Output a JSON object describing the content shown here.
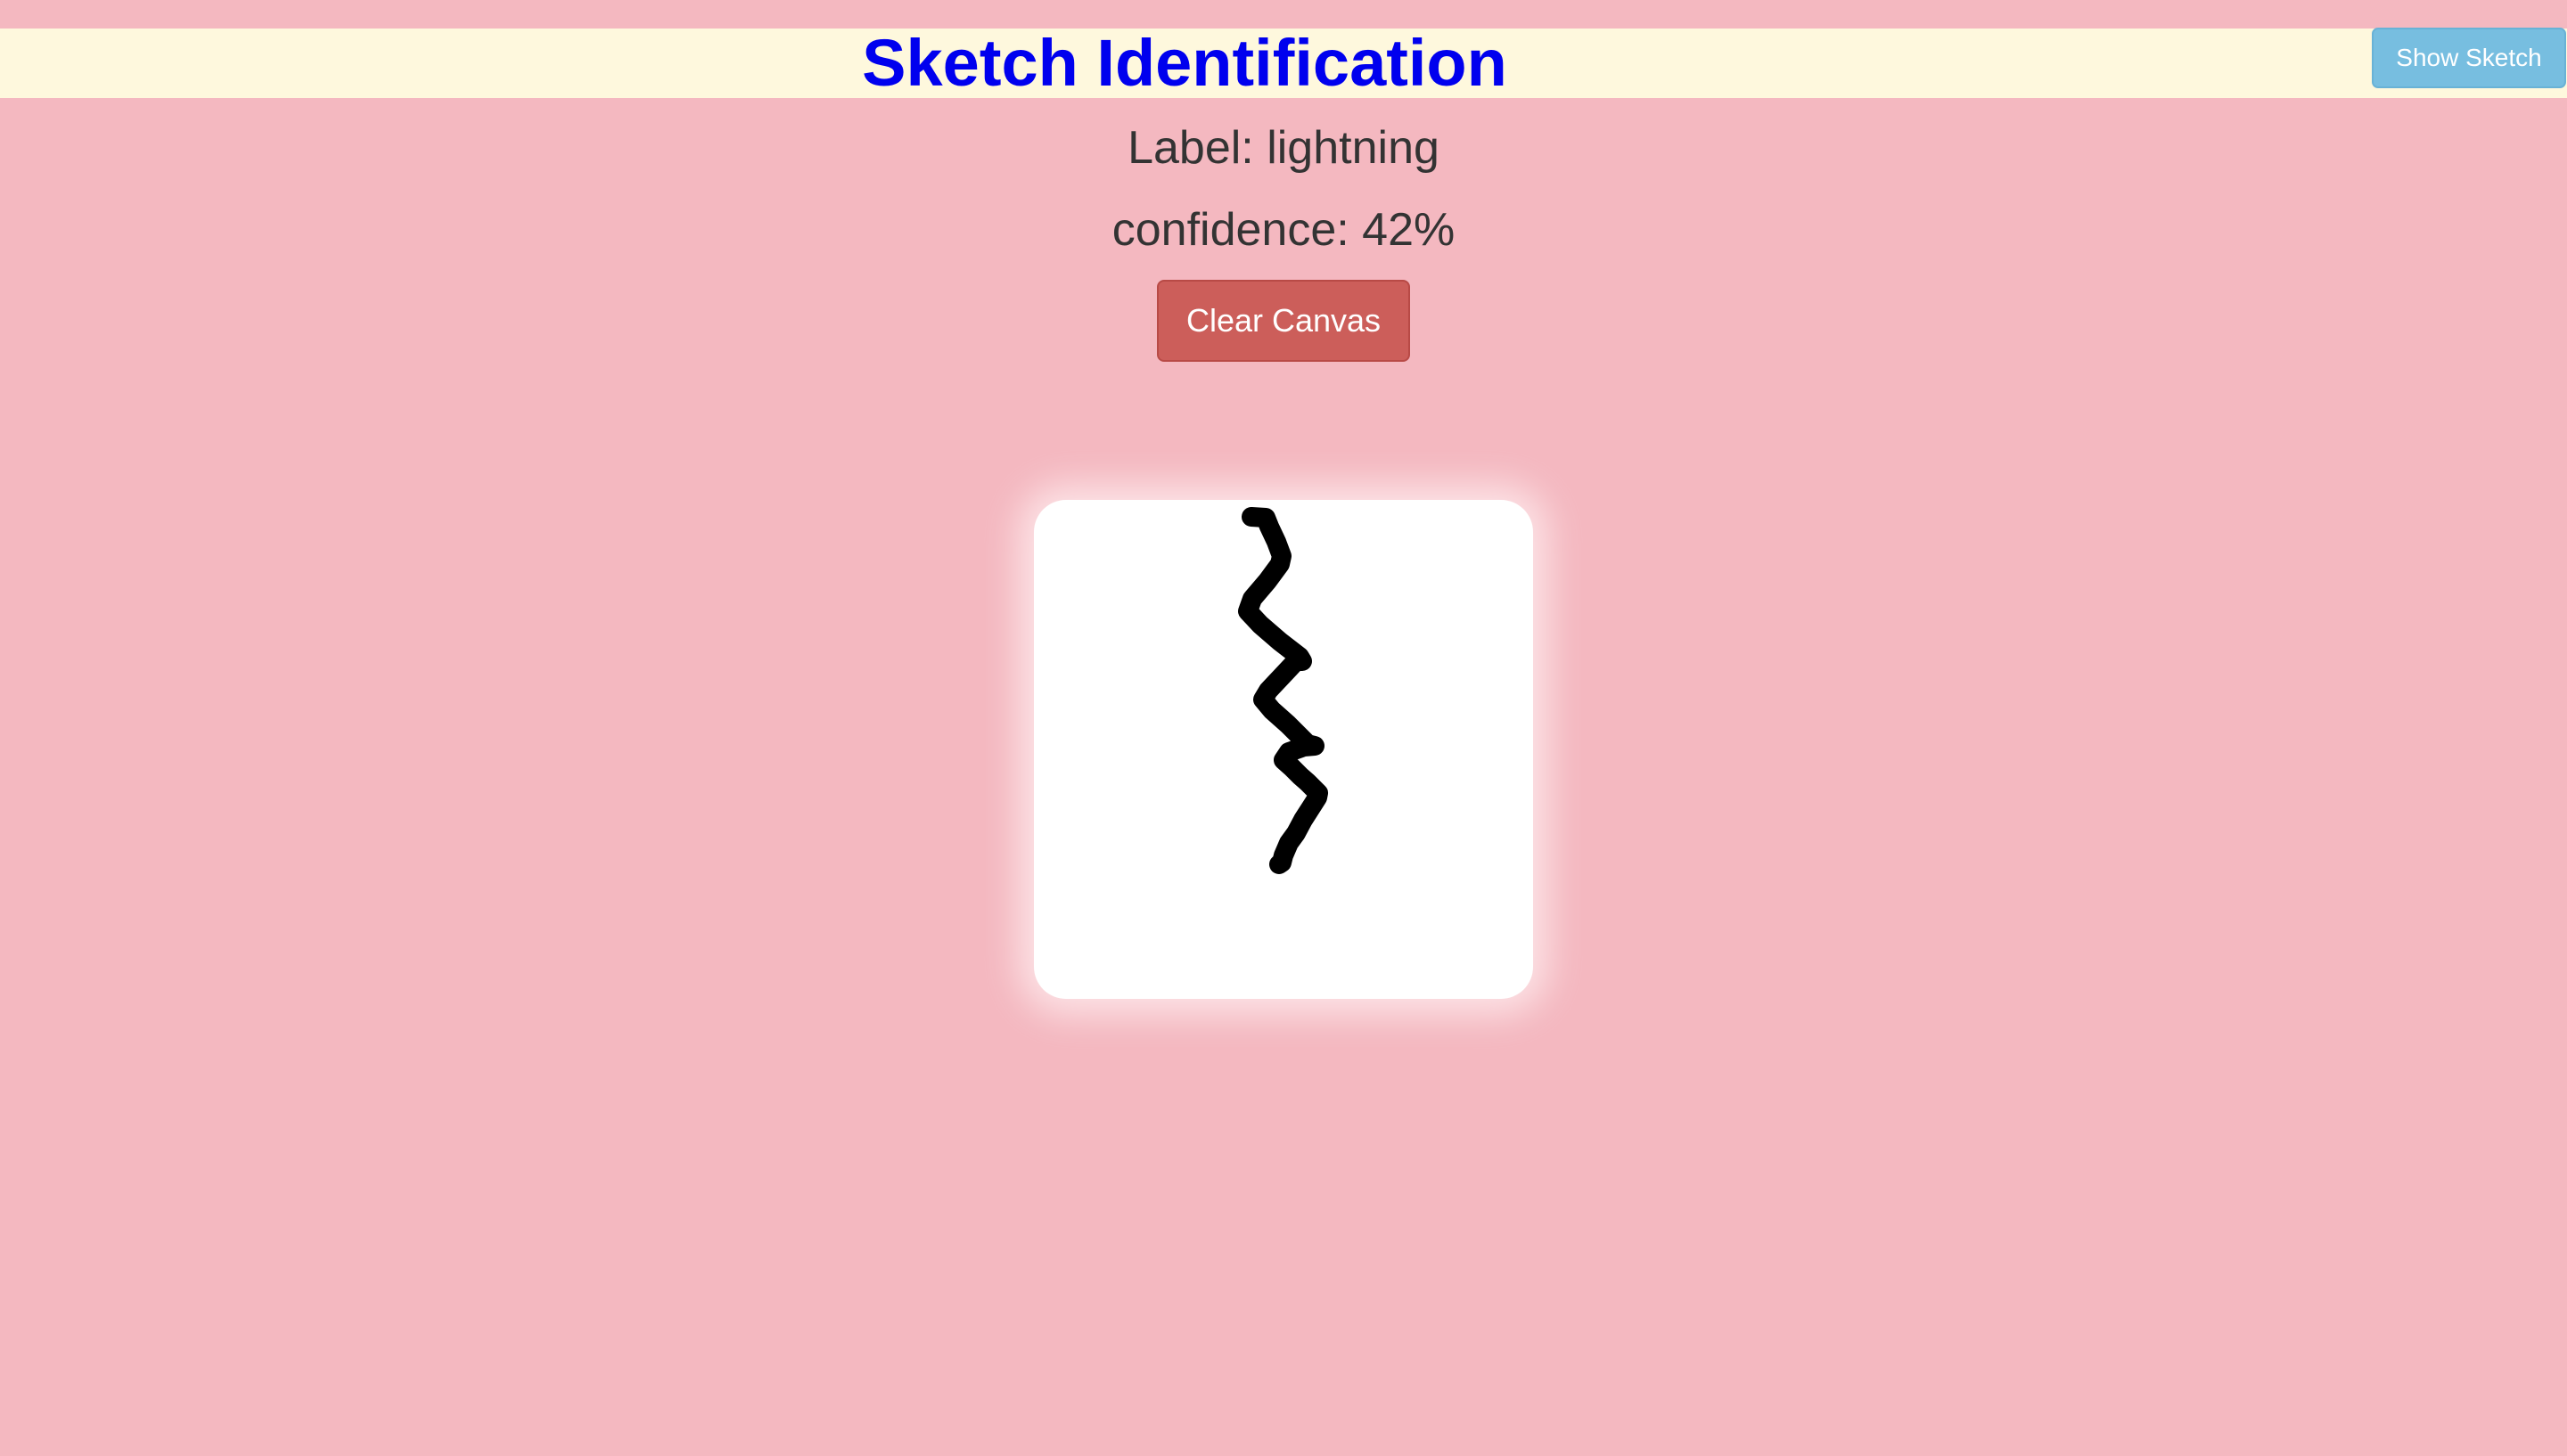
{
  "header": {
    "title": "Sketch Identification",
    "show_sketch_label": "Show Sketch",
    "background_color": "#fef8dd",
    "title_color": "#0000ee"
  },
  "result": {
    "label_text": "Label: lightning",
    "confidence_text": "confidence: 42%"
  },
  "controls": {
    "clear_canvas_label": "Clear Canvas",
    "clear_canvas_color": "#cc5e5a",
    "show_sketch_color": "#77bee0"
  },
  "canvas": {
    "background_color": "#ffffff",
    "stroke_color": "#000000"
  },
  "page": {
    "background_color": "#f4b8c0"
  }
}
